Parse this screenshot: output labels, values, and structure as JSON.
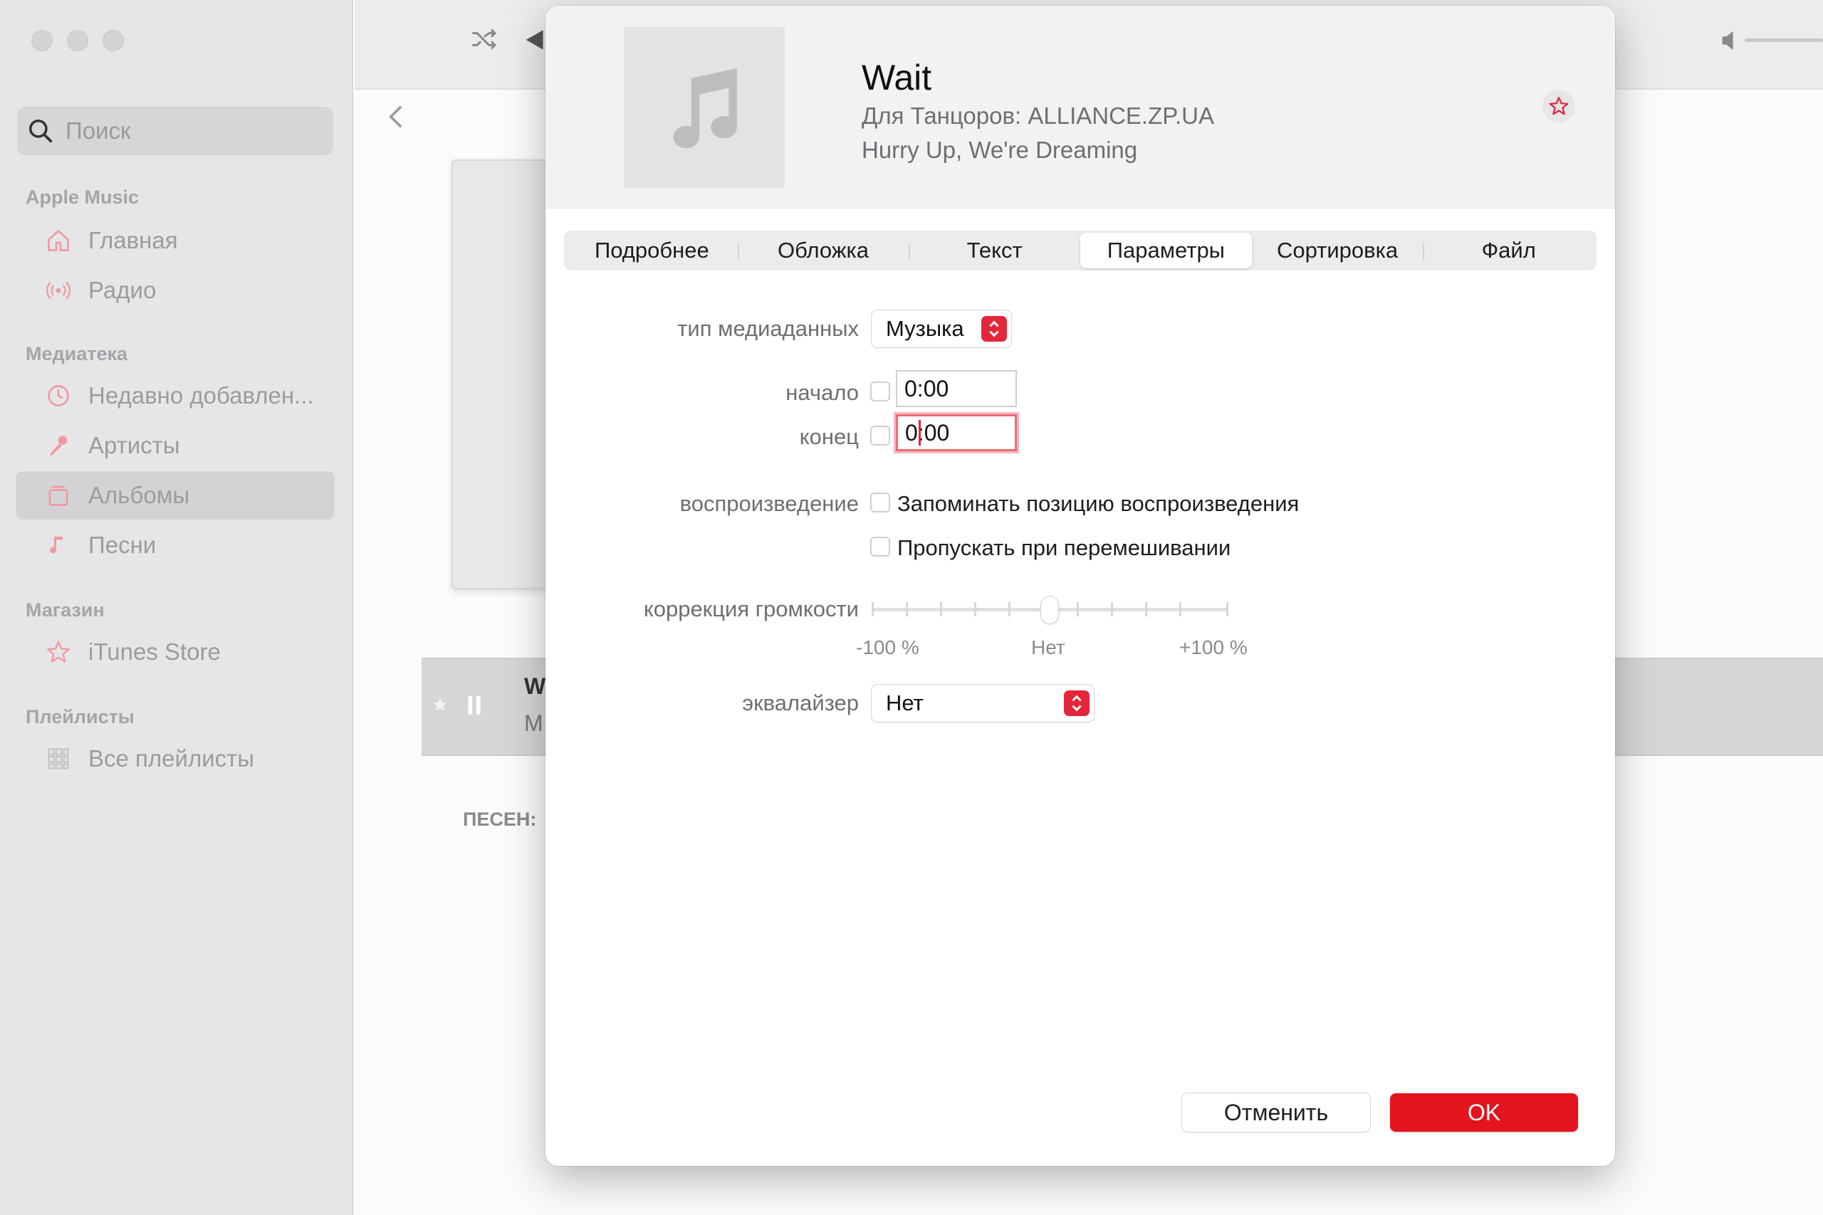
{
  "sidebar": {
    "search_placeholder": "Поиск",
    "sections": {
      "apple_music": "Apple Music",
      "library": "Медиатека",
      "store": "Магазин",
      "playlists": "Плейлисты"
    },
    "items": {
      "home": "Главная",
      "radio": "Радио",
      "recent": "Недавно добавлен...",
      "artists": "Артисты",
      "albums": "Альбомы",
      "songs": "Песни",
      "itunes_store": "iTunes Store",
      "all_playlists": "Все плейлисты"
    },
    "active_item": "albums"
  },
  "main": {
    "track_row": {
      "title_fragment": "W",
      "subtitle_fragment": "M"
    },
    "songs_label": "ПЕСЕН: "
  },
  "dialog": {
    "title": "Wait",
    "artist": "Для Танцоров: ALLIANCE.ZP.UA",
    "album": "Hurry Up, We're Dreaming",
    "tabs": [
      "Подробнее",
      "Обложка",
      "Текст",
      "Параметры",
      "Сортировка",
      "Файл"
    ],
    "selected_tab": "Параметры",
    "fields": {
      "media_type": {
        "label": "тип медиаданных",
        "value": "Музыка"
      },
      "start": {
        "label": "начало",
        "value": "0:00",
        "checked": false
      },
      "end": {
        "label": "конец",
        "value": "0:00",
        "checked": false
      },
      "playback": {
        "label": "воспроизведение",
        "remember_position": {
          "label": "Запоминать позицию воспроизведения",
          "checked": false
        },
        "skip_shuffle": {
          "label": "Пропускать при перемешивании",
          "checked": false
        }
      },
      "volume": {
        "label": "коррекция громкости",
        "min_label": "-100 %",
        "mid_label": "Нет",
        "max_label": "+100 %",
        "value_percent": 0
      },
      "equalizer": {
        "label": "эквалайзер",
        "value": "Нет"
      }
    },
    "buttons": {
      "cancel": "Отменить",
      "ok": "OK"
    }
  },
  "colors": {
    "accent_red": "#e3141e",
    "sidebar_bg": "#e6e6e8",
    "dialog_header_bg": "#f2f2f4"
  }
}
